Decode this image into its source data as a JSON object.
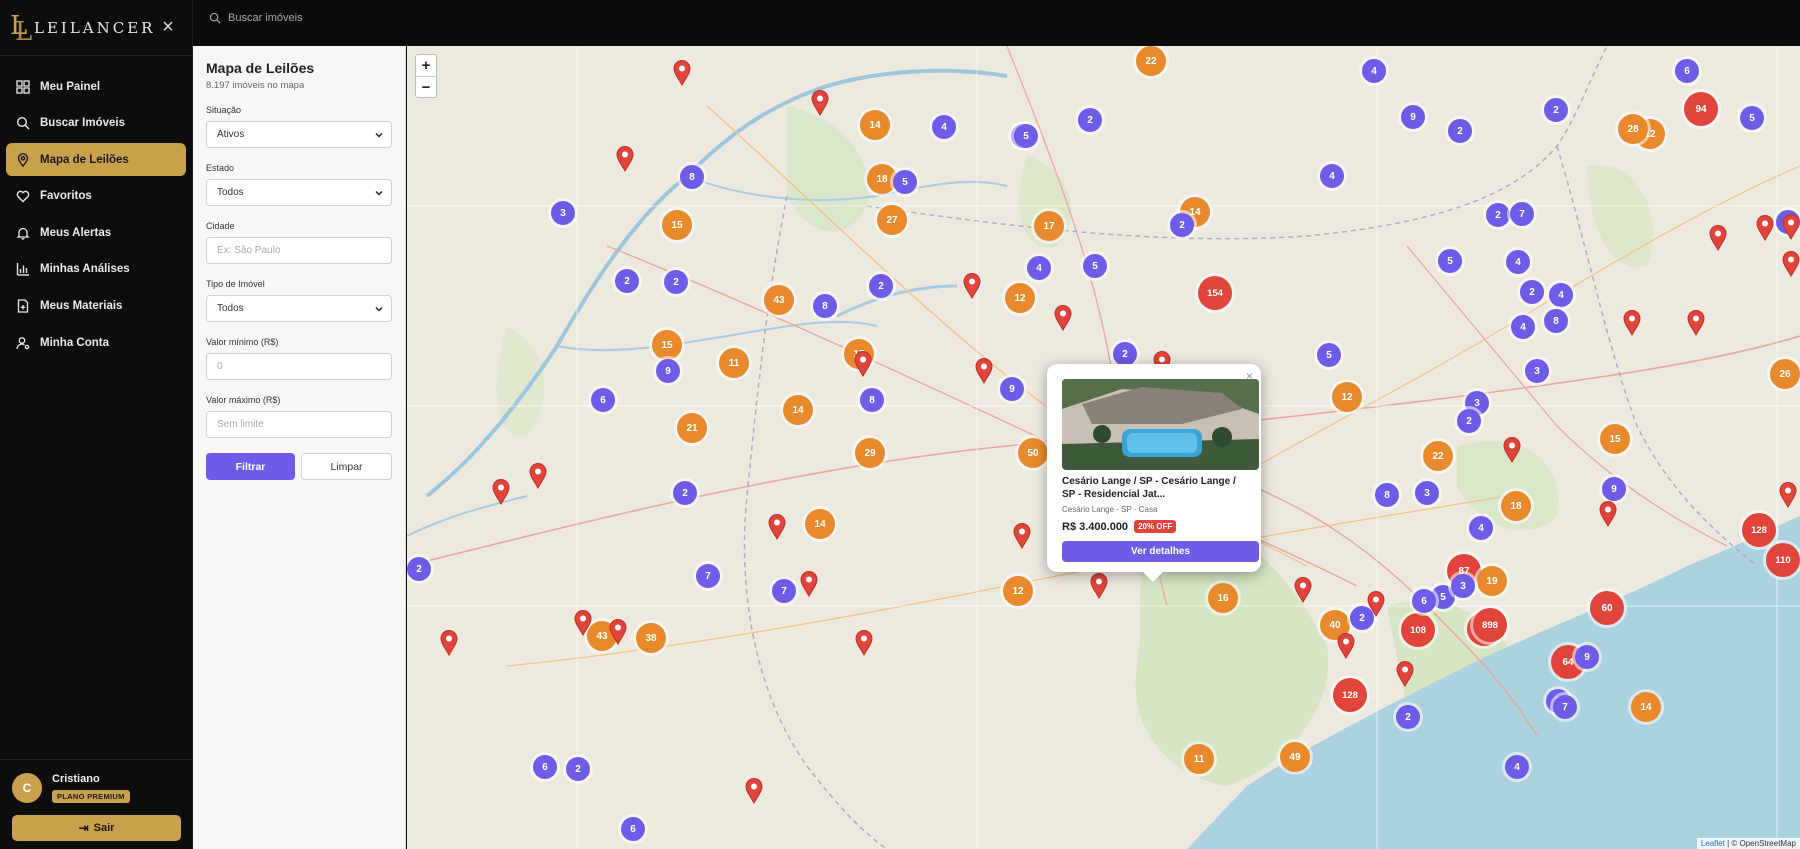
{
  "brand": {
    "name": "LEILANCER",
    "logo_letters": "LL"
  },
  "sidebar": {
    "items": [
      {
        "label": "Meu Painel",
        "icon": "dashboard-icon",
        "active": false
      },
      {
        "label": "Buscar Imóveis",
        "icon": "search-icon",
        "active": false
      },
      {
        "label": "Mapa de Leilões",
        "icon": "map-pin-icon",
        "active": true
      },
      {
        "label": "Favoritos",
        "icon": "heart-icon",
        "active": false
      },
      {
        "label": "Meus Alertas",
        "icon": "bell-icon",
        "active": false
      },
      {
        "label": "Minhas Análises",
        "icon": "bar-chart-icon",
        "active": false
      },
      {
        "label": "Meus Materiais",
        "icon": "file-icon",
        "active": false
      },
      {
        "label": "Minha Conta",
        "icon": "user-gear-icon",
        "active": false
      }
    ],
    "user": {
      "initial": "C",
      "name": "Cristiano",
      "plan": "PLANO PREMIUM"
    },
    "logout_label": "Sair"
  },
  "topbar": {
    "search_placeholder": "Buscar imóveis"
  },
  "filters": {
    "title": "Mapa de Leilões",
    "count": "8.197 imóveis no mapa",
    "situacao": {
      "label": "Situação",
      "value": "Ativos"
    },
    "estado": {
      "label": "Estado",
      "value": "Todos"
    },
    "cidade": {
      "label": "Cidade",
      "placeholder": "Ex: São Paulo"
    },
    "tipo": {
      "label": "Tipo de Imóvel",
      "value": "Todos"
    },
    "valor_min": {
      "label": "Valor mínimo (R$)",
      "placeholder": "0"
    },
    "valor_max": {
      "label": "Valor máximo (R$)",
      "placeholder": "Sem limite"
    },
    "filter_button": "Filtrar",
    "clear_button": "Limpar"
  },
  "map": {
    "zoom_in": "+",
    "zoom_out": "−",
    "attribution_leaflet": "Leaflet",
    "attribution_osm": "| © OpenStreetMap",
    "colors": {
      "small": "#6c5ce7",
      "medium": "#e88a2c",
      "large": "#e0443a",
      "pin": "#e0443a"
    },
    "clusters": [
      "22",
      "4",
      "6",
      "9",
      "94",
      "2",
      "2",
      "12",
      "28",
      "14",
      "4",
      "8",
      "2",
      "4",
      "18",
      "5",
      "5",
      "4",
      "2",
      "3",
      "15",
      "17",
      "14",
      "5",
      "7",
      "27",
      "4",
      "5",
      "7",
      "2",
      "4",
      "2",
      "2",
      "2",
      "5",
      "2",
      "43",
      "8",
      "154",
      "12",
      "4",
      "4",
      "15",
      "17",
      "2",
      "5",
      "8",
      "9",
      "11",
      "6",
      "8",
      "9",
      "12",
      "3",
      "3",
      "2",
      "21",
      "14",
      "29",
      "50",
      "22",
      "5",
      "8",
      "9",
      "15",
      "2",
      "14",
      "4",
      "3",
      "18",
      "128",
      "110",
      "26",
      "2",
      "7",
      "7",
      "12",
      "16",
      "87",
      "19",
      "5",
      "43",
      "38",
      "40",
      "73",
      "3",
      "2",
      "108",
      "60",
      "898",
      "64",
      "9",
      "14",
      "3",
      "6",
      "2",
      "128",
      "7",
      "49",
      "6",
      "2",
      "11",
      "4",
      "6"
    ],
    "cluster_types": [
      "o",
      "p",
      "p",
      "p",
      "r",
      "p",
      "p",
      "o",
      "o",
      "o",
      "p",
      "p",
      "p",
      "p",
      "o",
      "p",
      "p",
      "p",
      "p",
      "p",
      "o",
      "o",
      "o",
      "p",
      "p",
      "o",
      "p",
      "p",
      "p",
      "p",
      "p",
      "p",
      "p",
      "p",
      "p",
      "p",
      "o",
      "p",
      "r",
      "o",
      "p",
      "p",
      "o",
      "o",
      "p",
      "p",
      "p",
      "p",
      "o",
      "p",
      "p",
      "p",
      "o",
      "p",
      "p",
      "p",
      "o",
      "o",
      "o",
      "o",
      "o",
      "p",
      "p",
      "p",
      "o",
      "p",
      "o",
      "p",
      "p",
      "o",
      "r",
      "r",
      "o",
      "p",
      "p",
      "p",
      "o",
      "o",
      "r",
      "o",
      "p",
      "o",
      "o",
      "o",
      "r",
      "p",
      "p",
      "r",
      "r",
      "r",
      "r",
      "p",
      "o",
      "p",
      "p",
      "p",
      "r",
      "p",
      "o",
      "p",
      "p",
      "o",
      "p",
      "p"
    ],
    "pin_count": 33
  },
  "popup": {
    "title": "Cesário Lange / SP - Cesário Lange / SP - Residencial Jat...",
    "subtitle": "Cesário Lange - SP · Casa",
    "price": "R$ 3.400.000",
    "discount": "20% OFF",
    "button": "Ver detalhes",
    "close": "×"
  }
}
